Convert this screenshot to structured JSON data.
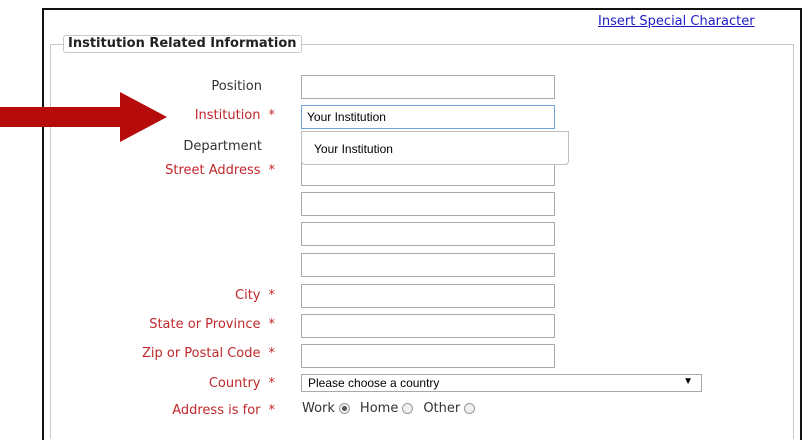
{
  "links": {
    "special_char": "Insert Special Character"
  },
  "section": {
    "title": "Institution Related Information"
  },
  "fields": {
    "position": {
      "label": "Position",
      "value": ""
    },
    "institution": {
      "label": "Institution",
      "value": "Your Institution"
    },
    "department": {
      "label": "Department",
      "value": ""
    },
    "street": {
      "label": "Street Address",
      "values": [
        "",
        "",
        "",
        ""
      ]
    },
    "city": {
      "label": "City",
      "value": ""
    },
    "state": {
      "label": "State or Province",
      "value": ""
    },
    "zip": {
      "label": "Zip or Postal Code",
      "value": ""
    },
    "country": {
      "label": "Country",
      "selected": "Please choose a country"
    },
    "address_for": {
      "label": "Address is for",
      "options": [
        "Work",
        "Home",
        "Other"
      ],
      "selected": "Work"
    }
  },
  "autocomplete": {
    "suggestion": "Your Institution"
  },
  "required_marker": "*",
  "colors": {
    "required": "#c0282b",
    "link": "#1c1cc9",
    "arrow": "#b50b0b"
  },
  "icons": {
    "arrow": "red-arrow-icon",
    "caret": "dropdown-caret-icon"
  }
}
